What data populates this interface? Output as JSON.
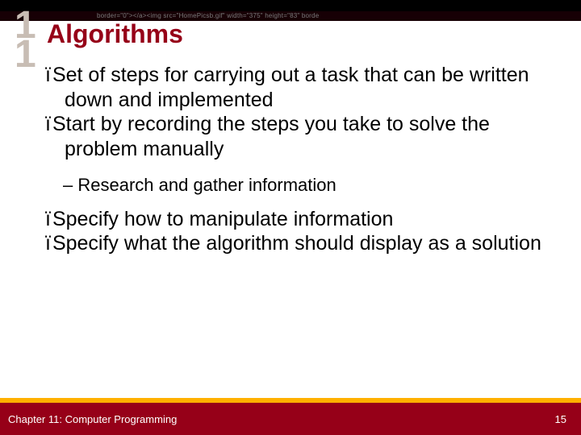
{
  "codestrip": "border=\"0\"></a><img src=\"HomePicsb.gif\" width=\"375\" height=\"83\" borde",
  "chapter_number": {
    "line1": "1",
    "line2": "1"
  },
  "title": "Algorithms",
  "body": {
    "b1": "Set of steps for carrying out a task that can be written down and implemented",
    "b2": "Start by recording the steps you take to solve the problem manually",
    "s1": "Research and gather information",
    "b3": "Specify how to manipulate information",
    "b4": "Specify what the algorithm should display as a solution"
  },
  "bullet_glyph": "ï",
  "dash_glyph": "– ",
  "footer": {
    "left": "Chapter 11: Computer Programming",
    "right": "15"
  }
}
